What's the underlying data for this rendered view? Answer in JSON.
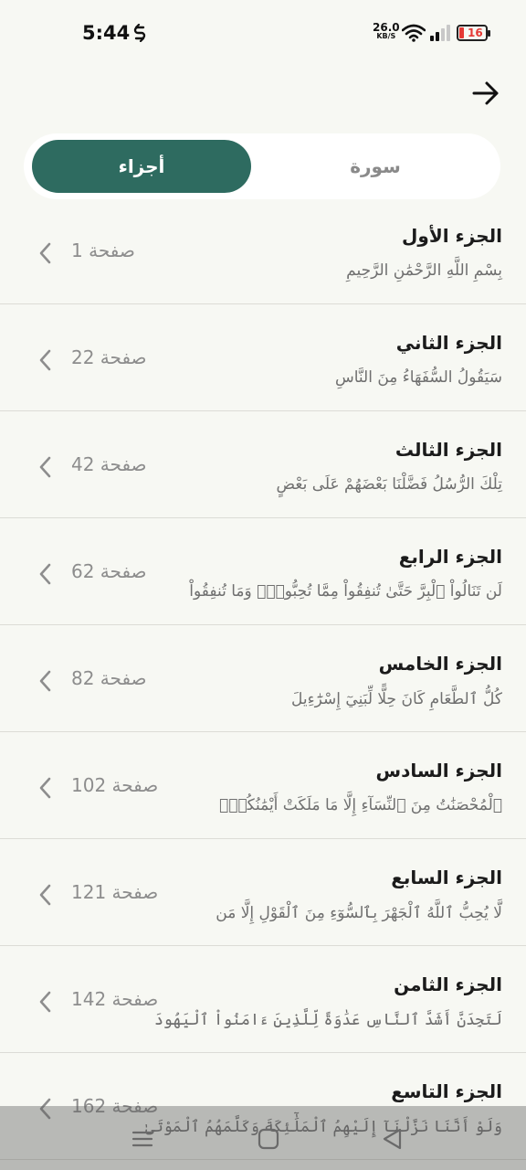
{
  "status_bar": {
    "time": "5:44",
    "net_speed": "26.0",
    "net_unit": "KB/S",
    "battery": "16"
  },
  "colors": {
    "accent": "#2e6b60",
    "background": "#f7f8f3",
    "battery_low": "#e53935"
  },
  "tabs": {
    "active": "أجزاء",
    "inactive": "سورة"
  },
  "juz_list": [
    {
      "name": "الجزء الأول",
      "verse": "بِسْمِ اللَّهِ الرَّحْمَٰنِ الرَّحِيمِ",
      "page": "صفحة 1"
    },
    {
      "name": "الجزء الثاني",
      "verse": "سَيَقُولُ السُّفَهَاءُ مِنَ النَّاسِ",
      "page": "صفحة 22"
    },
    {
      "name": "الجزء الثالث",
      "verse": "تِلْكَ الرُّسُلُ فَضَّلْنَا بَعْضَهُمْ عَلَى بَعْضٍ",
      "page": "صفحة 42"
    },
    {
      "name": "الجزء الرابع",
      "verse": "لَن تَنَالُواْ ٱلْبِرَّ حَتَّىٰ تُنفِقُواْ مِمَّا تُحِبُّونَۚ وَمَا تُنفِقُواْ",
      "page": "صفحة 62"
    },
    {
      "name": "الجزء الخامس",
      "verse": "كُلُّ ٱلطَّعَامِ كَانَ حِلًّا لِّبَنِيٓ إِسْرَٰٓءِيلَ",
      "page": "صفحة 82"
    },
    {
      "name": "الجزء السادس",
      "verse": "ٱلْمُحْصَنَٰتُ مِنَ ٱلنِّسَآءِ إِلَّا مَا مَلَكَتْ أَيْمَٰنُكُمْۖ",
      "page": "صفحة 102"
    },
    {
      "name": "الجزء السابع",
      "verse": "لَّا يُحِبُّ ٱللَّهُ ٱلْجَهْرَ بِٱلسُّوٓءِ مِنَ ٱلْقَوْلِ إِلَّا مَن",
      "page": "صفحة 121"
    },
    {
      "name": "الجزء الثامن",
      "verse": "لَتَجِدَنَّ أَشَدَّ ٱلنَّاسِ عَدَٰوَةً لِّلَّذِينَ ءَامَنُواْ ٱلْيَهُودَ",
      "page": "صفحة 142"
    },
    {
      "name": "الجزء التاسع",
      "verse": "وَلَوْ أَنَّنَا نَزَّلْنَآ إِلَيْهِمُ ٱلْمَلَٰٓئِكَةَ وَكَلَّمَهُمُ ٱلْمَوْتَىٰ",
      "page": "صفحة 162"
    }
  ],
  "icons": {
    "back": "arrow-right-icon",
    "chevron": "chevron-left-icon",
    "nav_menu": "menu-icon",
    "nav_home": "home-icon",
    "nav_back": "back-triangle-icon"
  }
}
